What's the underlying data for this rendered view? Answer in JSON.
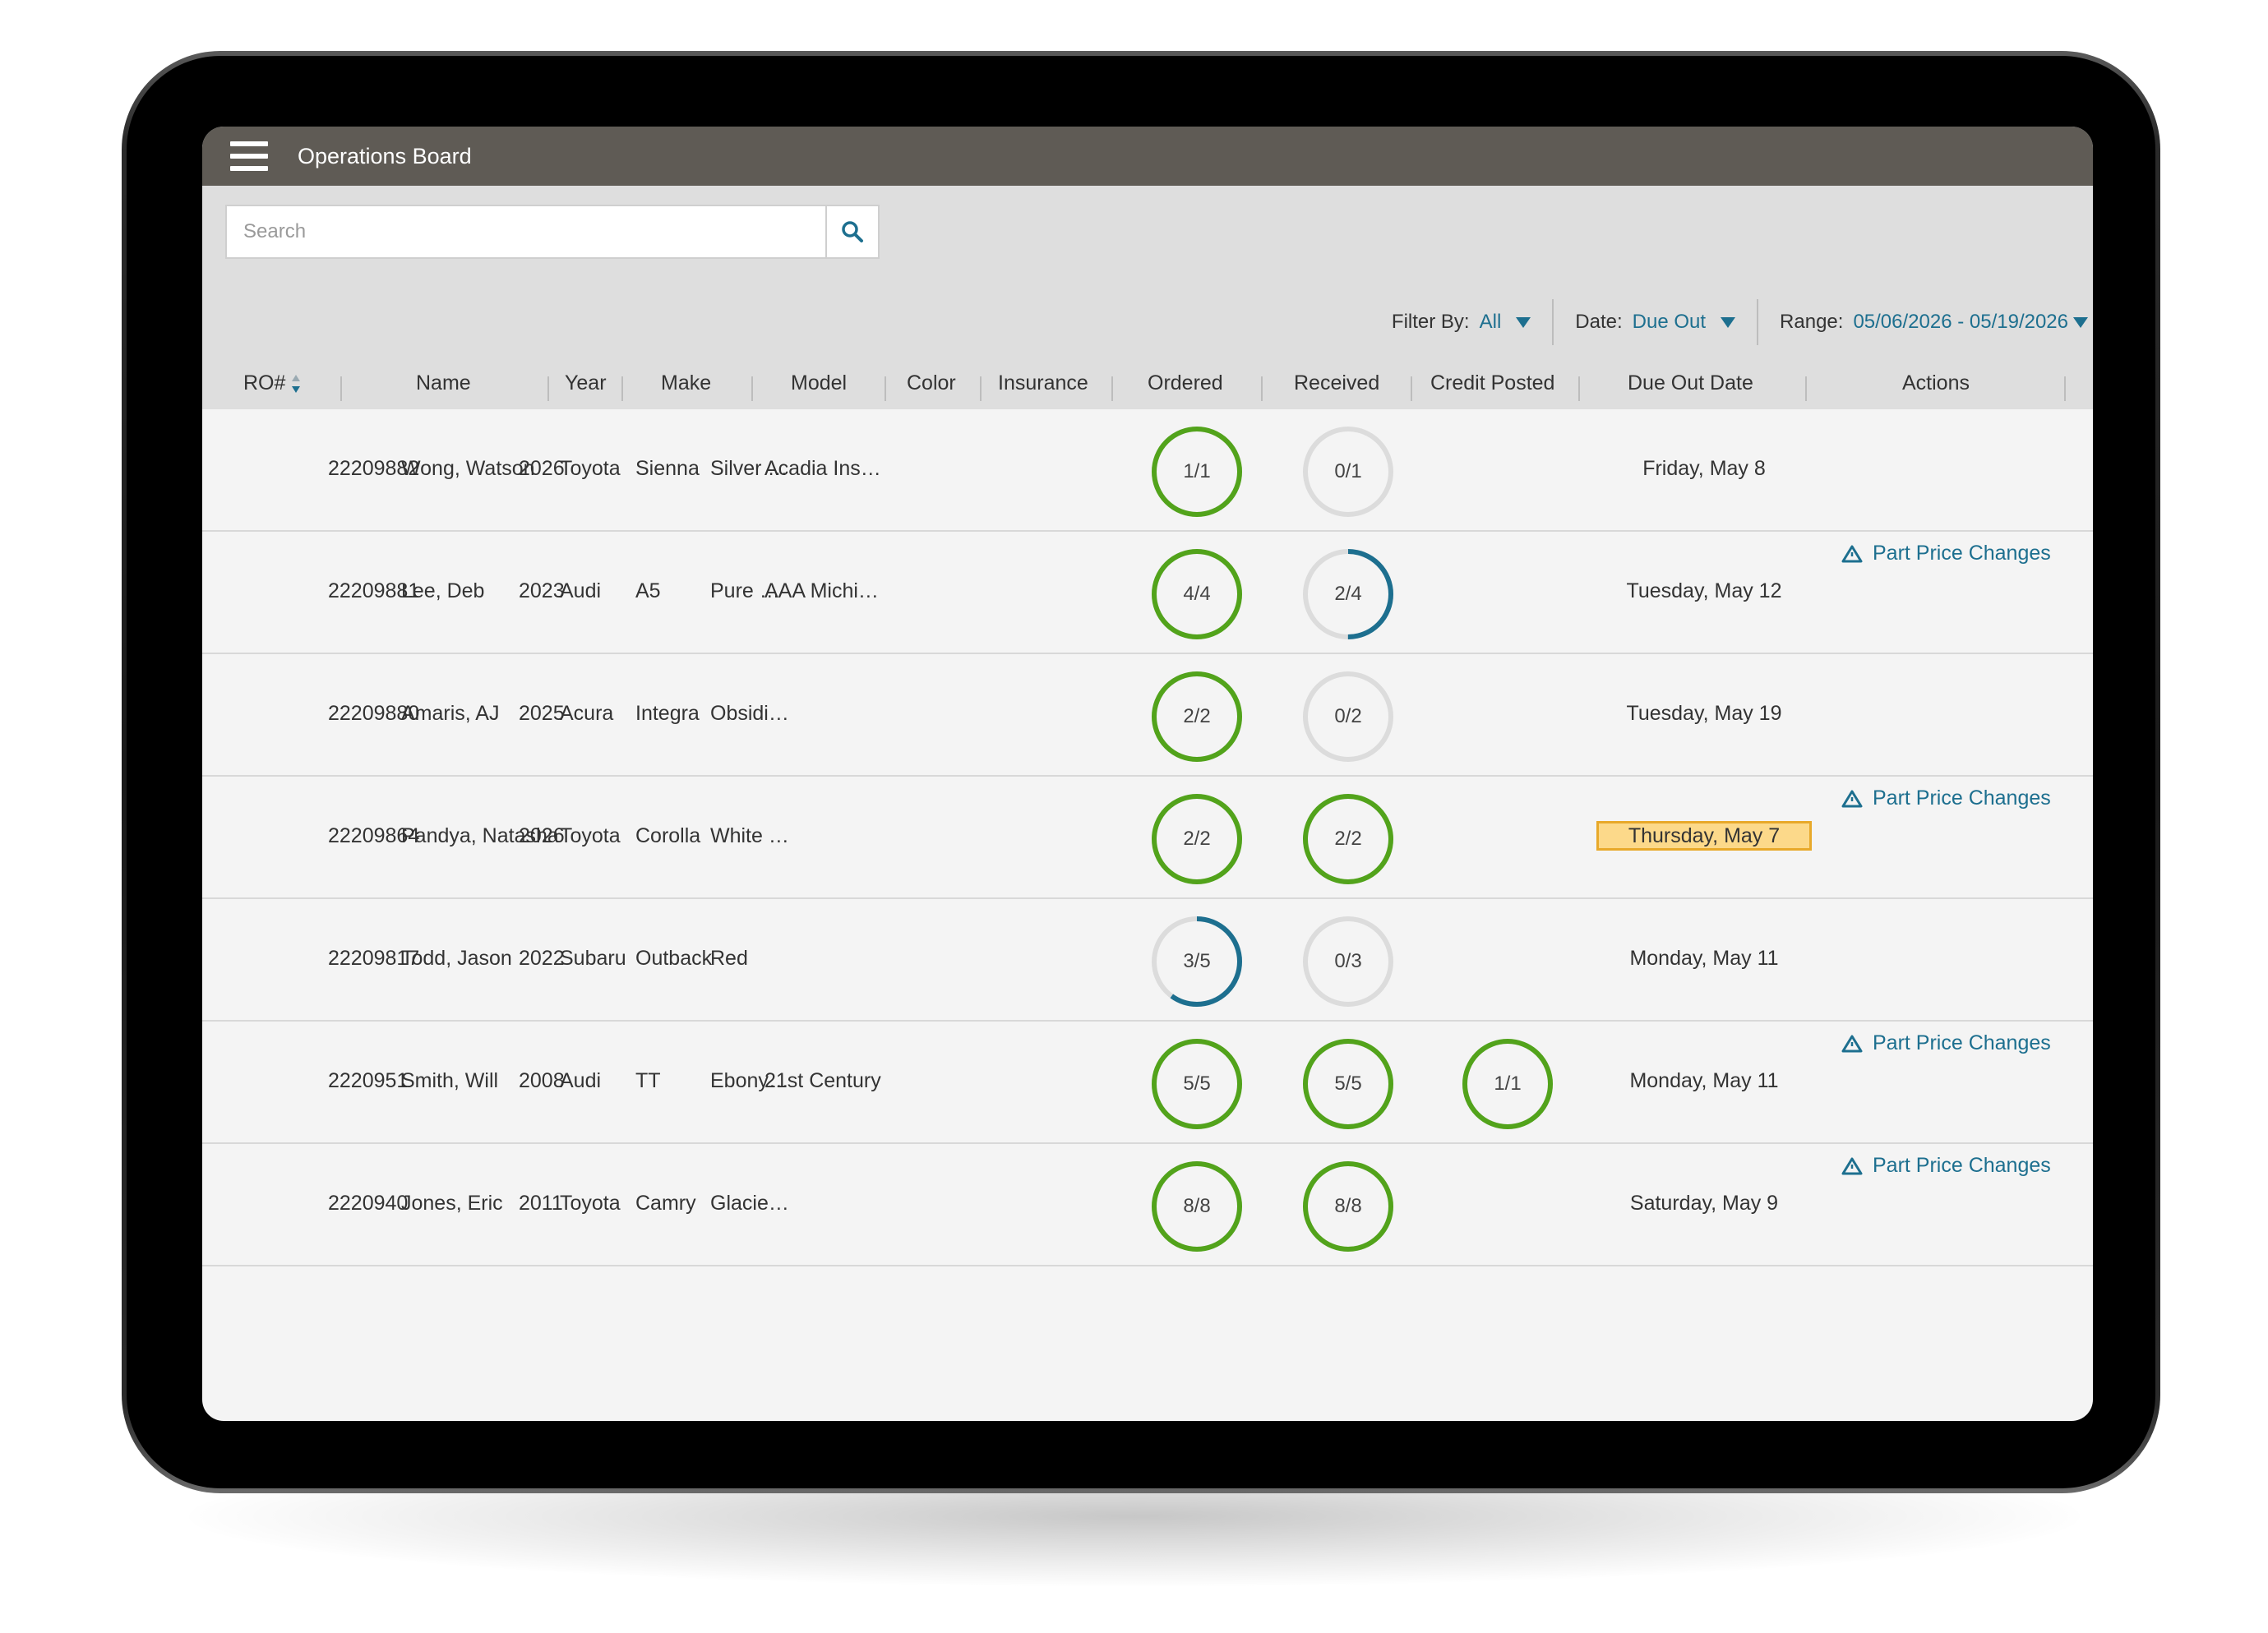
{
  "app": {
    "title": "Operations Board",
    "menu_icon": "hamburger-icon"
  },
  "search": {
    "placeholder": "Search",
    "icon": "search-icon"
  },
  "filters": {
    "filter_by": {
      "label": "Filter By:",
      "value": "All"
    },
    "date": {
      "label": "Date:",
      "value": "Due Out"
    },
    "range": {
      "label": "Range:",
      "value": "05/06/2026 - 05/19/2026"
    }
  },
  "columns": {
    "ro": "RO#",
    "name": "Name",
    "year": "Year",
    "make": "Make",
    "model": "Model",
    "color": "Color",
    "insurance": "Insurance",
    "ordered": "Ordered",
    "received": "Received",
    "credit": "Credit Posted",
    "due": "Due Out Date",
    "actions": "Actions"
  },
  "colors": {
    "complete": "#52a31b",
    "partial": "#1d6f8f",
    "empty": "#dcdcdc",
    "highlight": "#fcd98a",
    "header": "#5f5b55"
  },
  "rows": [
    {
      "ro": "22209882",
      "name": "Wong, Watson",
      "year": "2026",
      "make": "Toyota",
      "model": "Sienna",
      "color": "Silver …",
      "insurance": "Acadia Ins…",
      "ordered": {
        "text": "1/1",
        "fraction": 1
      },
      "received": {
        "text": "0/1",
        "fraction": 0
      },
      "credit": null,
      "due": "Friday, May 8",
      "due_highlight": false,
      "action": ""
    },
    {
      "ro": "22209881",
      "name": "Lee, Deb",
      "year": "2023",
      "make": "Audi",
      "model": "A5",
      "color": "Pure …",
      "insurance": "AAA Michi…",
      "ordered": {
        "text": "4/4",
        "fraction": 1
      },
      "received": {
        "text": "2/4",
        "fraction": 0.5
      },
      "credit": null,
      "due": "Tuesday, May 12",
      "due_highlight": false,
      "action": "Part Price Changes"
    },
    {
      "ro": "22209880",
      "name": "Amaris, AJ",
      "year": "2025",
      "make": "Acura",
      "model": "Integra",
      "color": "Obsidi…",
      "insurance": "",
      "ordered": {
        "text": "2/2",
        "fraction": 1
      },
      "received": {
        "text": "0/2",
        "fraction": 0
      },
      "credit": null,
      "due": "Tuesday, May 19",
      "due_highlight": false,
      "action": ""
    },
    {
      "ro": "22209864",
      "name": "Pandya, Natasha",
      "year": "2026",
      "make": "Toyota",
      "model": "Corolla",
      "color": "White …",
      "insurance": "",
      "ordered": {
        "text": "2/2",
        "fraction": 1
      },
      "received": {
        "text": "2/2",
        "fraction": 1
      },
      "credit": null,
      "due": "Thursday, May 7",
      "due_highlight": true,
      "action": "Part Price Changes"
    },
    {
      "ro": "22209817",
      "name": "Todd, Jason",
      "year": "2022",
      "make": "Subaru",
      "model": "Outback",
      "color": "Red",
      "insurance": "",
      "ordered": {
        "text": "3/5",
        "fraction": 0.6
      },
      "received": {
        "text": "0/3",
        "fraction": 0
      },
      "credit": null,
      "due": "Monday, May 11",
      "due_highlight": false,
      "action": ""
    },
    {
      "ro": "2220951",
      "name": "Smith, Will",
      "year": "2008",
      "make": "Audi",
      "model": "TT",
      "color": "Ebony…",
      "insurance": "21st Century",
      "ordered": {
        "text": "5/5",
        "fraction": 1
      },
      "received": {
        "text": "5/5",
        "fraction": 1
      },
      "credit": {
        "text": "1/1",
        "fraction": 1
      },
      "due": "Monday, May 11",
      "due_highlight": false,
      "action": "Part Price Changes"
    },
    {
      "ro": "2220940",
      "name": "Jones, Eric",
      "year": "2011",
      "make": "Toyota",
      "model": "Camry",
      "color": "Glacie…",
      "insurance": "",
      "ordered": {
        "text": "8/8",
        "fraction": 1
      },
      "received": {
        "text": "8/8",
        "fraction": 1
      },
      "credit": null,
      "due": "Saturday, May 9",
      "due_highlight": false,
      "action": "Part Price Changes"
    }
  ]
}
